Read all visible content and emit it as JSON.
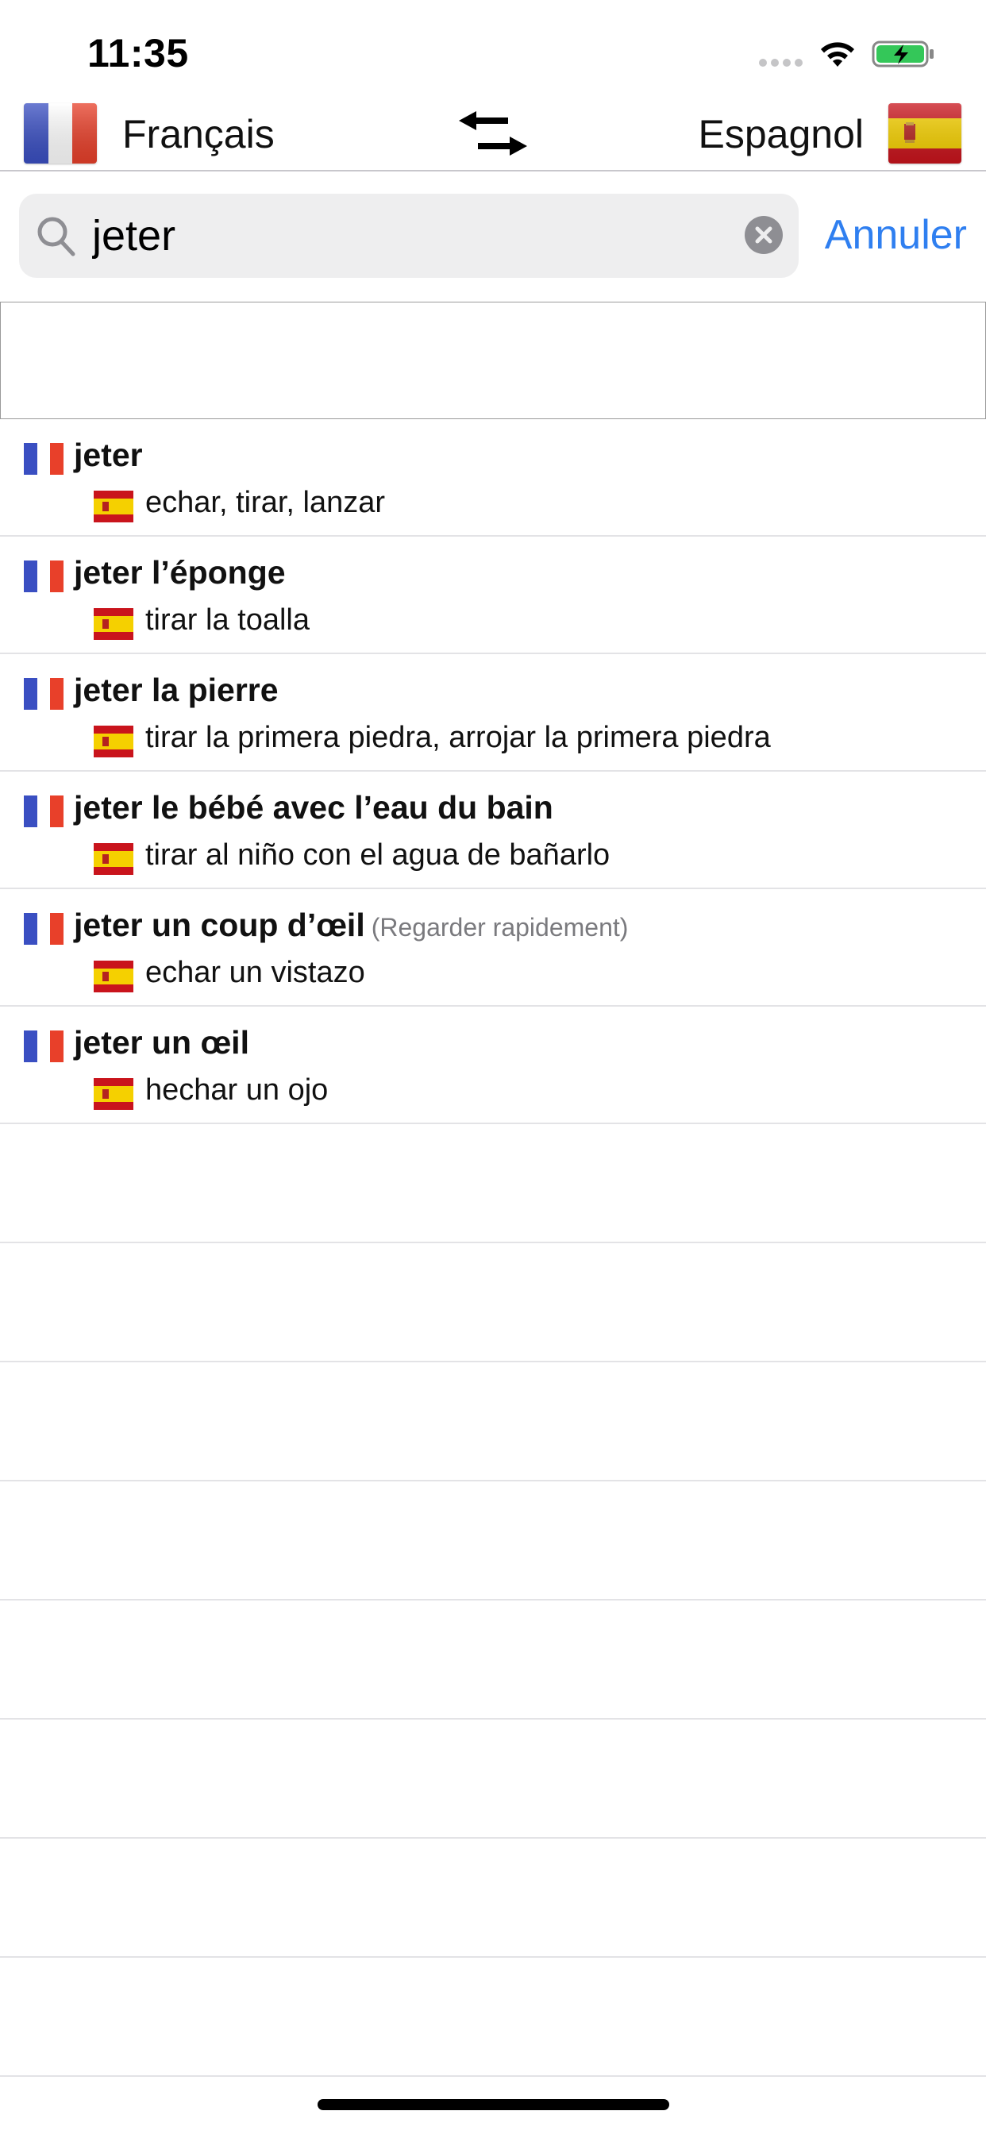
{
  "status_bar": {
    "time": "11:35"
  },
  "header": {
    "source_language": "Français",
    "target_language": "Espagnol",
    "source_flag": "flag-france-icon",
    "target_flag": "flag-spain-icon",
    "swap_icon": "swap-arrows-icon"
  },
  "search": {
    "value": "jeter",
    "cancel_label": "Annuler"
  },
  "colors": {
    "accent": "#2f7ff0",
    "separator": "#e3e3e6",
    "search_bg": "#eeeeef",
    "france_blue": "#3a4fc2",
    "france_red": "#e8402a",
    "spain_red": "#c9141c",
    "spain_yellow": "#f5d000"
  },
  "results": [
    {
      "term": "jeter",
      "note": "",
      "translation": "echar, tirar, lanzar"
    },
    {
      "term": "jeter l’éponge",
      "note": "",
      "translation": "tirar la toalla"
    },
    {
      "term": "jeter la pierre",
      "note": "",
      "translation": "tirar la primera piedra, arrojar la primera piedra"
    },
    {
      "term": "jeter le bébé avec l’eau du bain",
      "note": "",
      "translation": "tirar al niño con el agua de bañarlo"
    },
    {
      "term": "jeter un coup d’œil",
      "note": "(Regarder rapidement)",
      "translation": "echar un vistazo"
    },
    {
      "term": "jeter un œil",
      "note": "",
      "translation": "hechar un ojo"
    }
  ]
}
